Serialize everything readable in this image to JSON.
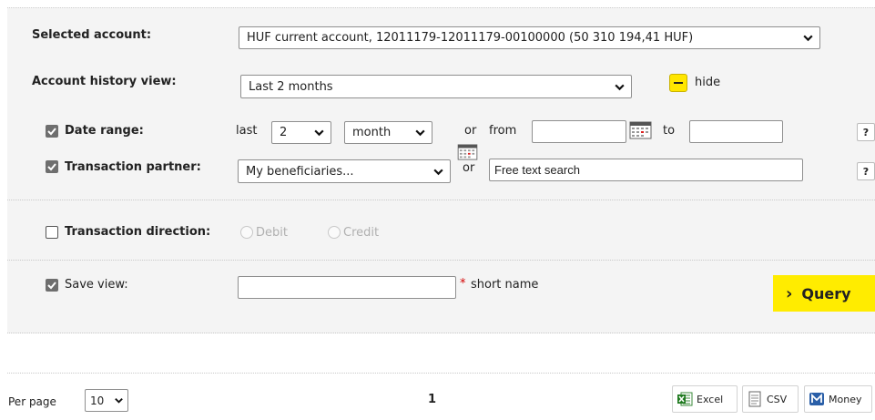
{
  "account": {
    "label": "Selected account:",
    "value": "HUF current account, 12011179-12011179-00100000 (50 310 194,41 HUF)"
  },
  "history_view": {
    "label": "Account history view:",
    "value": "Last 2 months",
    "hide_label": "hide"
  },
  "date_range": {
    "label": "Date range:",
    "checked": true,
    "last_label": "last",
    "count_value": "2",
    "unit_value": "month",
    "or_label": "or",
    "from_label": "from",
    "from_value": "",
    "to_label": "to",
    "to_value": "",
    "help": "?"
  },
  "partner": {
    "label": "Transaction partner:",
    "checked": true,
    "select_value": "My beneficiaries...",
    "or_label": "or",
    "text_value": "Free text search",
    "help": "?"
  },
  "direction": {
    "label": "Transaction direction:",
    "checked": false,
    "debit_label": "Debit",
    "credit_label": "Credit"
  },
  "save_view": {
    "label": "Save view:",
    "checked": true,
    "name_value": "",
    "required_mark": "*",
    "hint": "short name"
  },
  "query_button": {
    "arrow": "›",
    "label": "Query"
  },
  "pagination": {
    "per_page_label": "Per page",
    "per_page_value": "10",
    "current_page": "1"
  },
  "export": {
    "excel": "Excel",
    "csv": "CSV",
    "money": "Money"
  },
  "colors": {
    "accent_yellow": "#ffec00",
    "panel_bg": "#f4f4f4"
  }
}
